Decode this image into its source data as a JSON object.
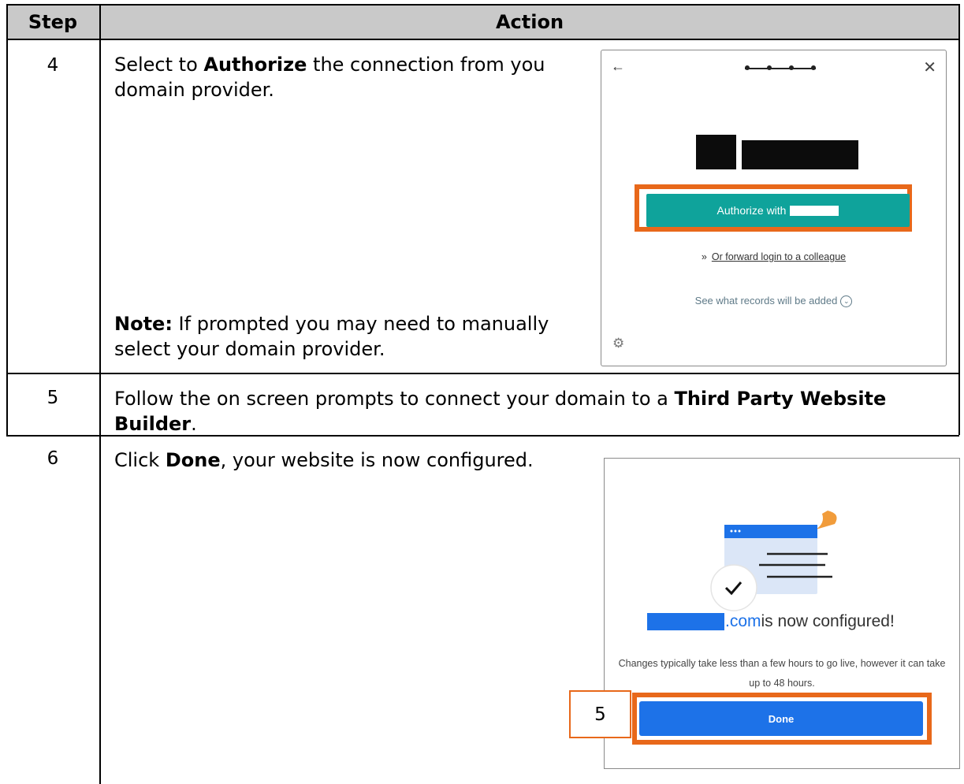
{
  "table": {
    "header_step": "Step",
    "header_action": "Action",
    "rows": [
      {
        "step": "4",
        "text_prefix": "Select to ",
        "text_bold": "Authorize",
        "text_suffix": " the connection from you domain provider.",
        "note_label": "Note:",
        "note_text": " If prompted you may need to manually select your domain provider."
      },
      {
        "step": "5",
        "text_prefix": "Follow the on screen prompts to connect your domain to a ",
        "text_bold": "Third Party Website Builder",
        "text_suffix": "."
      },
      {
        "step": "6",
        "text_prefix": "Click ",
        "text_bold": "Done",
        "text_suffix": ", your website is now configured."
      }
    ]
  },
  "authorize_dialog": {
    "back_icon": "arrow-left-icon",
    "close_icon": "close-icon",
    "progress_steps": 4,
    "button_label": "Authorize with",
    "forward_prefix": "»",
    "forward_link": "Or forward login to a colleague",
    "see_records": "See what records will be added",
    "settings_icon": "gear-icon",
    "button_color": "#0fa39b",
    "highlight_color": "#e8681a"
  },
  "configured_dialog": {
    "domain_suffix": ".com",
    "headline_rest": " is now configured!",
    "subtext": "Changes typically take less than a few hours to go live, however it can take up to 48 hours.",
    "done_label": "Done",
    "button_color": "#1d72e8",
    "callout_number": "5"
  }
}
